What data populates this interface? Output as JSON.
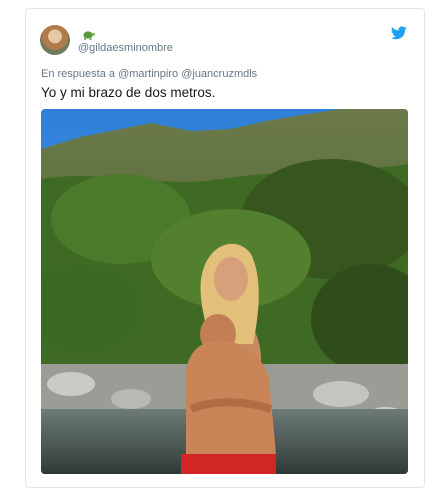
{
  "tweet": {
    "handle": "@gildaesminombre",
    "reply_prefix": "En respuesta a",
    "reply_mentions": [
      "@martinpiro",
      "@juancruzmdls"
    ],
    "text": "Yo y mi brazo de dos metros.",
    "author_emoji_icon": "turtle-icon",
    "brand_icon": "twitter-bird-icon"
  },
  "colors": {
    "brand": "#1da1f2",
    "secondary_text": "#657786",
    "primary_text": "#14171a",
    "border": "#e1e8ed"
  }
}
